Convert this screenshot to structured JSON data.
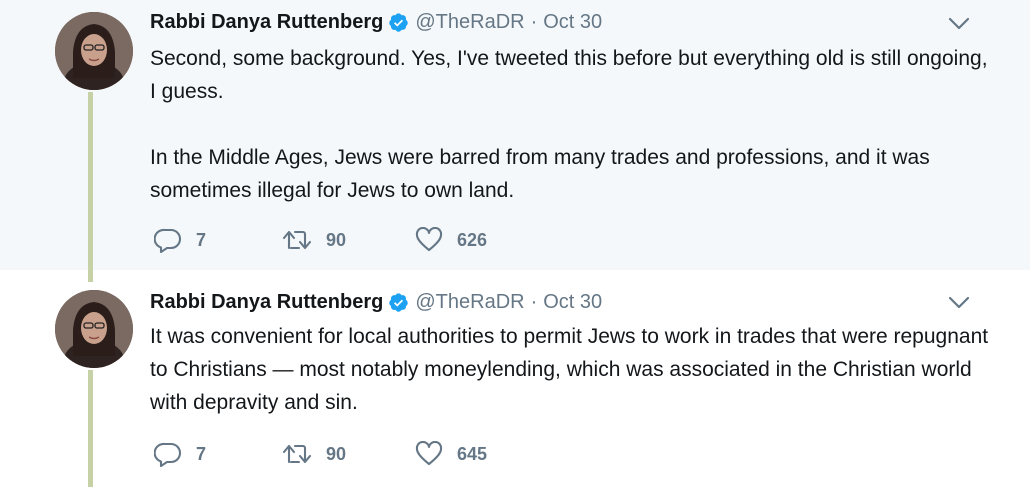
{
  "tweets": [
    {
      "author_name": "Rabbi Danya Ruttenberg",
      "handle": "@TheRaDR",
      "separator": "·",
      "date": "Oct 30",
      "paragraphs": [
        "Second, some background. Yes, I've tweeted this before but everything old is still ongoing, I guess.",
        "In the Middle Ages, Jews were barred from many trades and professions, and it was sometimes illegal for Jews to own land."
      ],
      "reply_count": "7",
      "retweet_count": "90",
      "like_count": "626"
    },
    {
      "author_name": "Rabbi Danya Ruttenberg",
      "handle": "@TheRaDR",
      "separator": "·",
      "date": "Oct 30",
      "paragraphs": [
        "It was convenient for local authorities to permit Jews to work in trades that were repugnant to Christians — most notably moneylending, which was associated in the Christian world with depravity and sin."
      ],
      "reply_count": "7",
      "retweet_count": "90",
      "like_count": "645"
    }
  ],
  "icons": {
    "verified": "verified-badge-icon",
    "caret": "chevron-down-icon",
    "reply": "reply-icon",
    "retweet": "retweet-icon",
    "like": "heart-icon"
  },
  "colors": {
    "verified_blue": "#1da1f2",
    "muted_text": "#657786",
    "thread_line": "#c6d2a6",
    "highlight_background": "#f5f8fa"
  }
}
